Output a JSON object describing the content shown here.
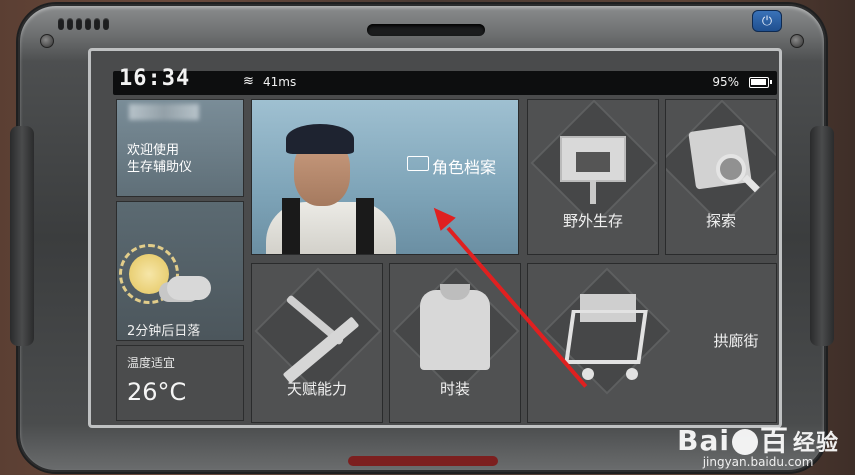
{
  "status": {
    "time": "16:34",
    "ping": "41ms",
    "battery": "95%",
    "battery_level": 0.95
  },
  "left": {
    "welcome": "欢迎使用\n生存辅助仪",
    "sunset": "2分钟后日落",
    "temp_label": "温度适宜",
    "temp_value": "26°C"
  },
  "tiles": {
    "profile": "角色档案",
    "wild": "野外生存",
    "explore": "探索",
    "talent": "天赋能力",
    "fashion": "时装",
    "mall": "拱廊街"
  },
  "watermark": {
    "logo": "Bai",
    "logo_tail": "百",
    "cn": "经验",
    "url": "jingyan.baidu.com"
  },
  "colors": {
    "arrow": "#e02020",
    "power_button": "#2f63a8"
  }
}
